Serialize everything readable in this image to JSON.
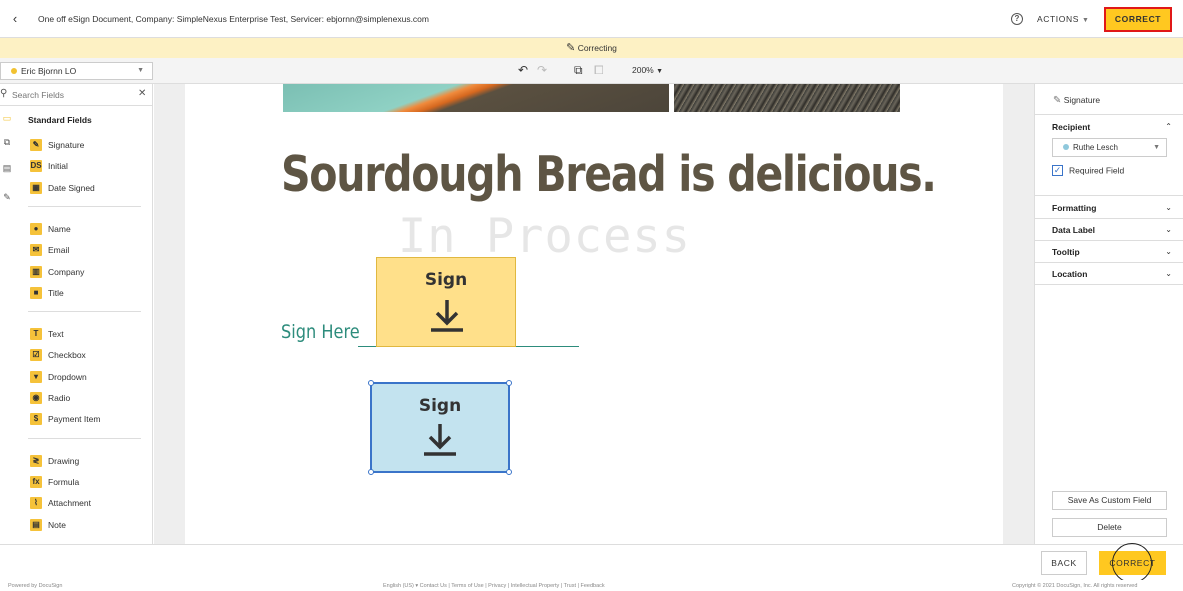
{
  "header": {
    "document_title": "One off eSign Document, Company: SimpleNexus Enterprise Test, Servicer: ebjornn@simplenexus.com",
    "actions_label": "ACTIONS",
    "correct_label": "CORRECT"
  },
  "banner": {
    "text": "Correcting"
  },
  "toolbar": {
    "recipient": "Eric Bjornn LO",
    "zoom": "200%"
  },
  "left_panel": {
    "search_placeholder": "Search Fields",
    "standard_header": "Standard Fields",
    "groups": [
      [
        {
          "label": "Signature",
          "icon": "signature-icon",
          "glyph": "✎"
        },
        {
          "label": "Initial",
          "icon": "initial-icon",
          "glyph": "DS"
        },
        {
          "label": "Date Signed",
          "icon": "calendar-icon",
          "glyph": "▦"
        }
      ],
      [
        {
          "label": "Name",
          "icon": "person-icon",
          "glyph": "●"
        },
        {
          "label": "Email",
          "icon": "envelope-icon",
          "glyph": "✉"
        },
        {
          "label": "Company",
          "icon": "building-icon",
          "glyph": "▥"
        },
        {
          "label": "Title",
          "icon": "briefcase-icon",
          "glyph": "■"
        }
      ],
      [
        {
          "label": "Text",
          "icon": "text-icon",
          "glyph": "T"
        },
        {
          "label": "Checkbox",
          "icon": "checkbox-icon",
          "glyph": "☑"
        },
        {
          "label": "Dropdown",
          "icon": "dropdown-icon",
          "glyph": "▾"
        },
        {
          "label": "Radio",
          "icon": "radio-icon",
          "glyph": "◉"
        },
        {
          "label": "Payment Item",
          "icon": "payment-icon",
          "glyph": "$"
        }
      ],
      [
        {
          "label": "Drawing",
          "icon": "drawing-icon",
          "glyph": "≷"
        },
        {
          "label": "Formula",
          "icon": "formula-icon",
          "glyph": "fx"
        },
        {
          "label": "Attachment",
          "icon": "paperclip-icon",
          "glyph": "⌇"
        },
        {
          "label": "Note",
          "icon": "note-icon",
          "glyph": "▤"
        }
      ]
    ]
  },
  "document": {
    "heading": "Sourdough Bread is delicious.",
    "watermark": "In Process",
    "sign_here_label": "Sign Here",
    "sign_tag_text": "Sign"
  },
  "right_panel": {
    "field_type": "Signature",
    "recipient_header": "Recipient",
    "recipient_value": "Ruthe Lesch",
    "required_label": "Required Field",
    "sections": [
      "Formatting",
      "Data Label",
      "Tooltip",
      "Location"
    ],
    "save_custom_label": "Save As Custom Field",
    "delete_label": "Delete"
  },
  "bottom_bar": {
    "back_label": "BACK",
    "correct_label": "CORRECT"
  },
  "footer": {
    "left": "Powered by DocuSign",
    "center": "English (US) ▾   Contact Us  |  Terms of Use  |  Privacy  |  Intellectual Property  |  Trust  |  Feedback",
    "right": "Copyright © 2021 DocuSign, Inc. All rights reserved"
  },
  "colors": {
    "accent_yellow": "#ffc820",
    "banner_yellow": "#fdf1c4",
    "selection_blue": "#3a74c9",
    "sign_here_teal": "#2d8c7c",
    "highlight_red": "#e01818"
  }
}
